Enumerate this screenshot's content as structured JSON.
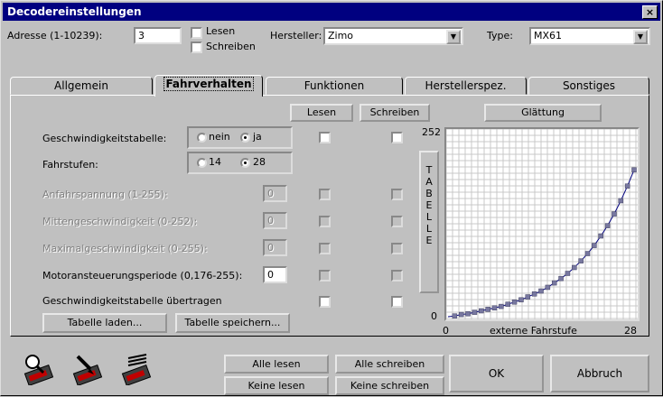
{
  "window": {
    "title": "Decodereinstellungen",
    "close_label": "×"
  },
  "header": {
    "address_label": "Adresse (1-10239):",
    "address_value": "3",
    "read_label": "Lesen",
    "write_label": "Schreiben",
    "manufacturer_label": "Hersteller:",
    "manufacturer_value": "Zimo",
    "type_label": "Type:",
    "type_value": "MX61"
  },
  "tabs": [
    {
      "label": "Allgemein"
    },
    {
      "label": "Fahrverhalten"
    },
    {
      "label": "Funktionen"
    },
    {
      "label": "Herstellerspez."
    },
    {
      "label": "Sonstiges"
    }
  ],
  "panel": {
    "read_button": "Lesen",
    "write_button": "Schreiben",
    "smooth_button": "Glättung",
    "speed_table_label": "Geschwindigkeitstabelle:",
    "speed_table_no": "nein",
    "speed_table_yes": "ja",
    "steps_label": "Fahrstufen:",
    "steps_14": "14",
    "steps_28": "28",
    "start_voltage_label": "Anfahrspannung (1-255):",
    "start_voltage_value": "0",
    "mid_speed_label": "Mittengeschwindigkeit (0-252):",
    "mid_speed_value": "0",
    "max_speed_label": "Maximalgeschwindigkeit (0-255):",
    "max_speed_value": "0",
    "motor_period_label": "Motoransteuerungsperiode (0,176-255):",
    "motor_period_value": "0",
    "transfer_table_label": "Geschwindigkeitstabelle übertragen",
    "load_table_button": "Tabelle laden...",
    "save_table_button": "Tabelle speichern...",
    "table_button_letters": [
      "T",
      "A",
      "B",
      "E",
      "L",
      "L",
      "E"
    ]
  },
  "chart_data": {
    "type": "line",
    "ymax_label": "252",
    "ymin_label": "0",
    "xmin_label": "0",
    "xlabel": "externe Fahrstufe",
    "xmax_label": "28",
    "xlim": [
      0,
      28
    ],
    "ylim": [
      0,
      252
    ],
    "x": [
      1,
      2,
      3,
      4,
      5,
      6,
      7,
      8,
      9,
      10,
      11,
      12,
      13,
      14,
      15,
      16,
      17,
      18,
      19,
      20,
      21,
      22,
      23,
      24,
      25,
      26,
      27,
      28
    ],
    "values": [
      1,
      3,
      4,
      6,
      8,
      10,
      12,
      14,
      17,
      20,
      23,
      27,
      31,
      35,
      40,
      46,
      52,
      59,
      67,
      76,
      86,
      97,
      110,
      124,
      140,
      158,
      178,
      200
    ]
  },
  "footer": {
    "read_all": "Alle lesen",
    "write_all": "Alle schreiben",
    "read_none": "Keine lesen",
    "write_none": "Keine schreiben",
    "ok": "OK",
    "cancel": "Abbruch"
  },
  "icons": [
    "read-decoder-icon",
    "write-decoder-icon",
    "program-decoder-icon"
  ]
}
